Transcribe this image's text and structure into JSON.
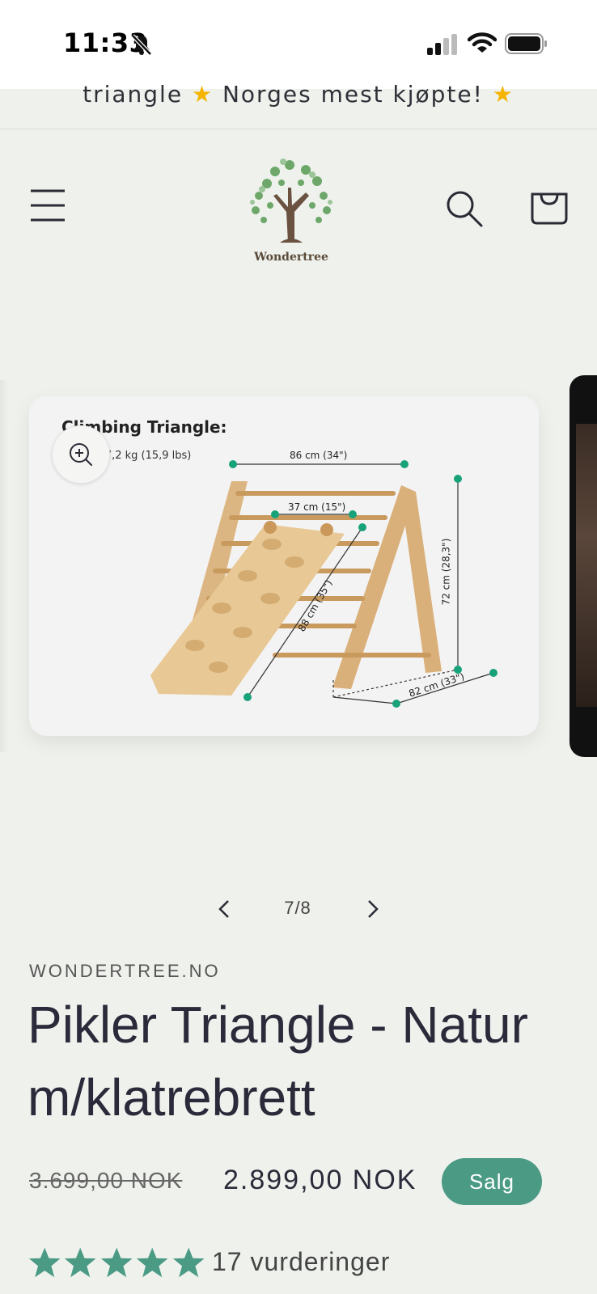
{
  "status": {
    "time": "11:33"
  },
  "announcement": {
    "text_before": "triangle",
    "text_after": "Norges mest kjøpte!"
  },
  "header": {
    "logo_text": "Wondertree"
  },
  "slide": {
    "title": "Climbing Triangle:",
    "weight": "Weight: 7,2 kg (15,9 lbs)",
    "dims": {
      "top_width": "86 cm (34\")",
      "ladder_width": "37 cm (15\")",
      "height": "72 cm (28,3\")",
      "ramp_length": "88 cm (35\")",
      "depth": "82 cm (33\")"
    }
  },
  "pager": {
    "count": "7/8"
  },
  "product": {
    "vendor": "WONDERTREE.NO",
    "title": "Pikler Triangle - Natur m/klatrebrett",
    "price_old": "3.699,00 NOK",
    "price_new": "2.899,00 NOK",
    "badge": "Salg",
    "rating_count_text": "17 vurderinger",
    "rating_stars": 5
  },
  "colors": {
    "accent": "#4a9a84",
    "background": "#eff1ec",
    "star": "#f4b400"
  }
}
